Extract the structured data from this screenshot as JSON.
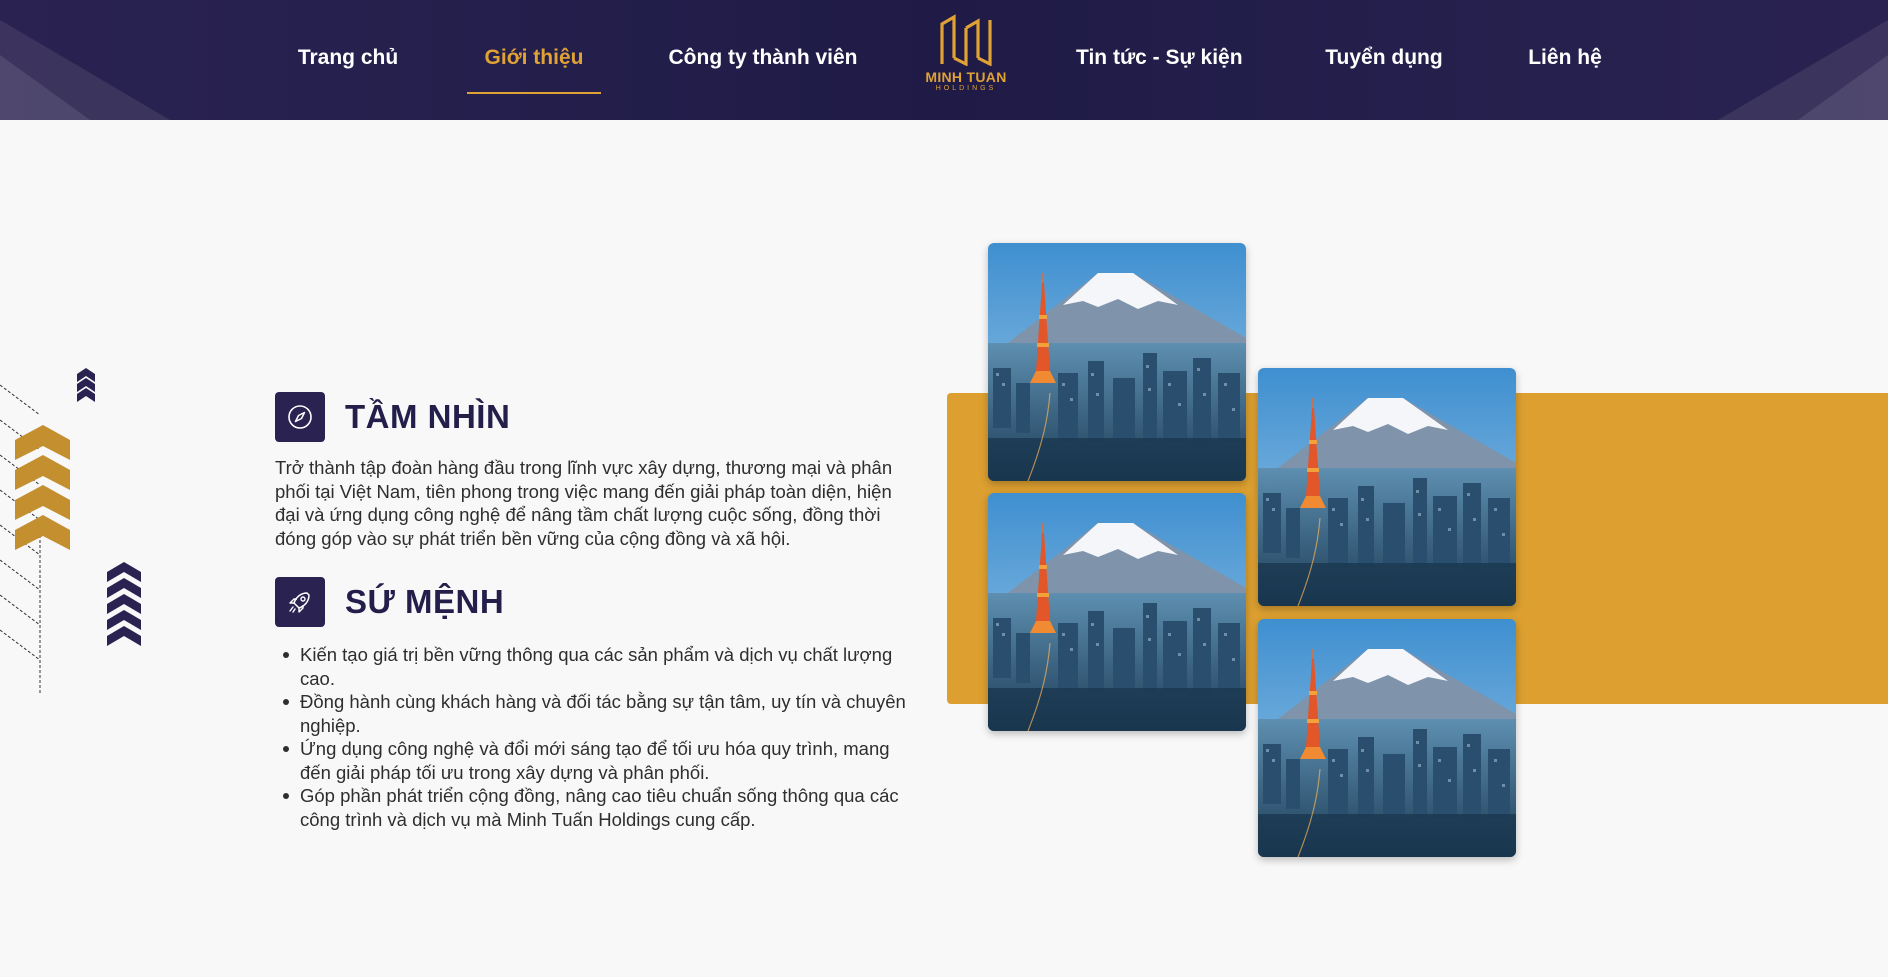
{
  "nav": {
    "items": [
      {
        "label": "Trang chủ",
        "active": false
      },
      {
        "label": "Giới thiệu",
        "active": true
      },
      {
        "label": "Công ty thành viên",
        "active": false
      },
      {
        "label": "Tin tức - Sự kiện",
        "active": false
      },
      {
        "label": "Tuyển dụng",
        "active": false
      },
      {
        "label": "Liên hệ",
        "active": false
      }
    ],
    "logo": {
      "name": "MINH TUAN",
      "sub": "HOLDINGS"
    }
  },
  "vision": {
    "icon": "compass-icon",
    "title": "TẦM NHÌN",
    "text": "Trở thành tập đoàn hàng đầu trong lĩnh vực xây dựng, thương mại và phân phối tại Việt Nam, tiên phong trong việc mang đến giải pháp toàn diện, hiện đại và ứng dụng công nghệ để nâng tầm chất lượng cuộc sống, đồng thời đóng góp vào sự phát triển bền vững của cộng đồng và xã hội."
  },
  "mission": {
    "icon": "rocket-icon",
    "title": "SỨ MỆNH",
    "items": [
      "Kiến tạo giá trị bền vững thông qua các sản phẩm và dịch vụ chất lượng cao.",
      "Đồng hành cùng khách hàng và đối tác bằng sự tận tâm, uy tín và chuyên nghiệp.",
      "Ứng dụng công nghệ và đổi mới sáng tạo để tối ưu hóa quy trình, mang đến giải pháp tối ưu trong xây dựng và phân phối.",
      "Góp phần phát triển cộng đồng, nâng cao tiêu chuẩn sống thông qua các công trình và dịch vụ mà Minh Tuấn Holdings cung cấp."
    ]
  },
  "colors": {
    "navy": "#2a2352",
    "gold": "#dc9f30",
    "nav_active": "#e0a235"
  }
}
